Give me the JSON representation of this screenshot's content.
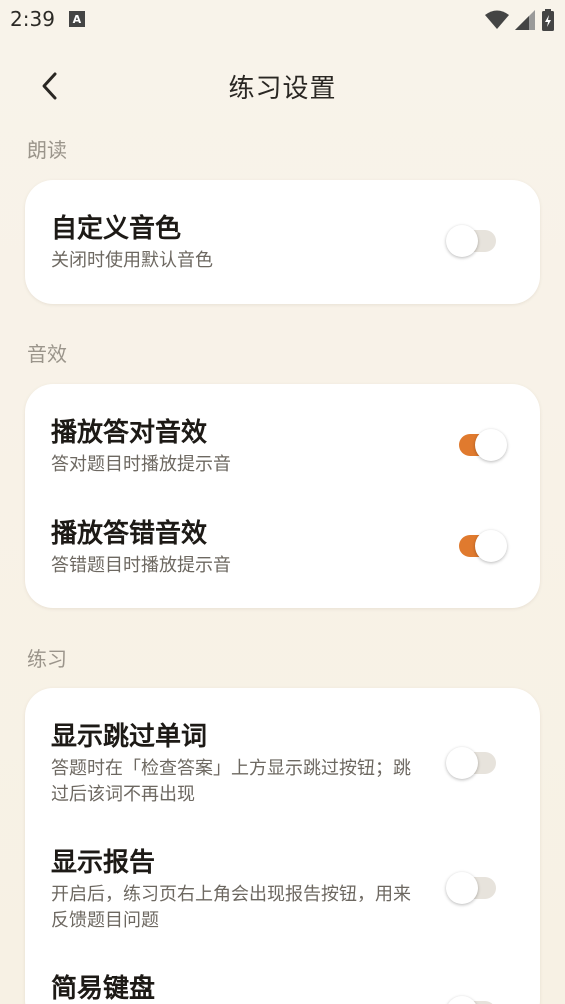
{
  "status_bar": {
    "time": "2:39",
    "notification_glyph": "A"
  },
  "header": {
    "title": "练习设置"
  },
  "sections": [
    {
      "label": "朗读",
      "items": [
        {
          "title": "自定义音色",
          "subtitle": "关闭时使用默认音色",
          "enabled": false
        }
      ]
    },
    {
      "label": "音效",
      "items": [
        {
          "title": "播放答对音效",
          "subtitle": "答对题目时播放提示音",
          "enabled": true
        },
        {
          "title": "播放答错音效",
          "subtitle": "答错题目时播放提示音",
          "enabled": true
        }
      ]
    },
    {
      "label": "练习",
      "items": [
        {
          "title": "显示跳过单词",
          "subtitle": "答题时在「检查答案」上方显示跳过按钮；跳过后该词不再出现",
          "enabled": false
        },
        {
          "title": "显示报告",
          "subtitle": "开启后，练习页右上角会出现报告按钮，用来反馈题目问题",
          "enabled": false
        },
        {
          "title": "简易键盘",
          "subtitle": "",
          "enabled": false
        }
      ]
    }
  ],
  "colors": {
    "accent": "#e07a2e",
    "background": "#f8f3ea",
    "card": "#ffffff",
    "section_label": "#9b958b"
  }
}
